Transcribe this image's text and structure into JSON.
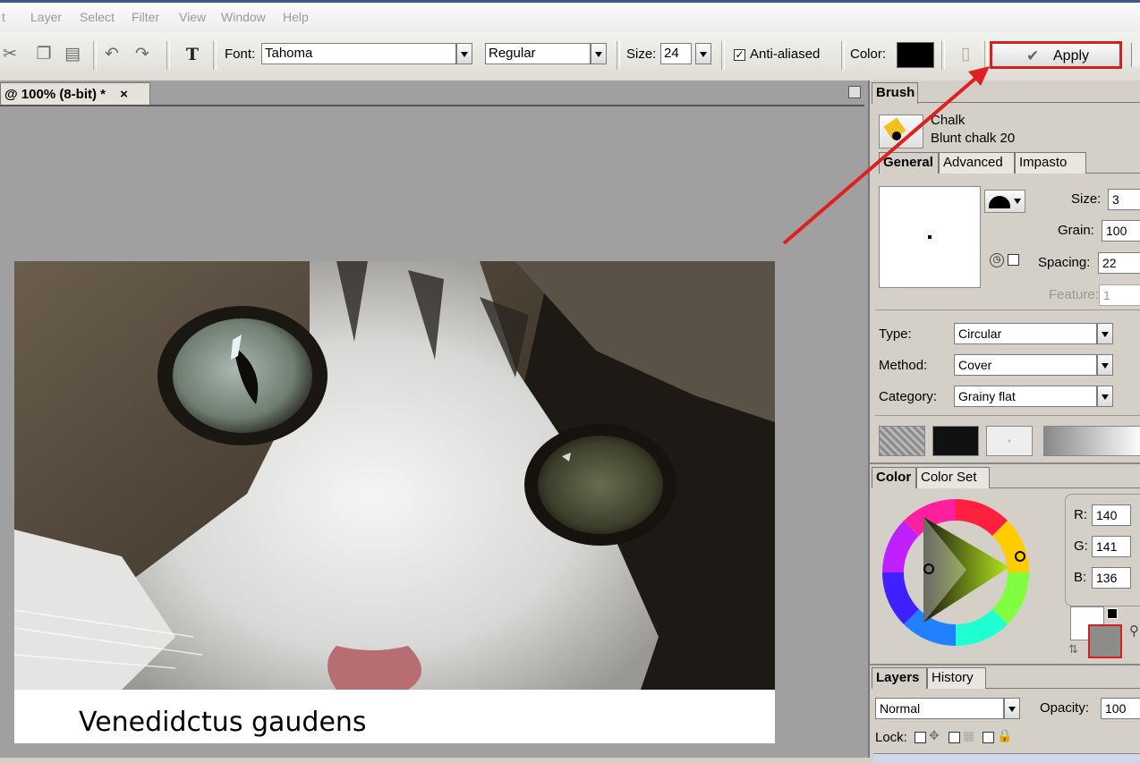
{
  "menu": [
    "t",
    "Layer",
    "Select",
    "Filter",
    "View",
    "Window",
    "Help"
  ],
  "toolbar": {
    "font_label": "Font:",
    "font_value": "Tahoma",
    "style_value": "Regular",
    "size_label": "Size:",
    "size_value": "24",
    "antialias_label": "Anti-aliased",
    "antialias_checked": true,
    "color_label": "Color:",
    "color_value": "#000000",
    "apply_label": "Apply"
  },
  "document": {
    "tab_title": "@ 100% (8-bit) *",
    "close_glyph": "×",
    "caption_text": "Venedidctus gaudens"
  },
  "brush": {
    "panel_tab": "Brush",
    "category_name": "Chalk",
    "variant_name": "Blunt chalk 20",
    "tabs": [
      "General",
      "Advanced",
      "Impasto"
    ],
    "size_label": "Size:",
    "size_value": "3",
    "grain_label": "Grain:",
    "grain_value": "100",
    "spacing_label": "Spacing:",
    "spacing_value": "22",
    "feature_label": "Feature:",
    "feature_value": "1",
    "type_label": "Type:",
    "type_value": "Circular",
    "method_label": "Method:",
    "method_value": "Cover",
    "category_label": "Category:",
    "category_value": "Grainy flat"
  },
  "color": {
    "tabs": [
      "Color",
      "Color Set"
    ],
    "r_label": "R:",
    "r_value": "140",
    "g_label": "G:",
    "g_value": "141",
    "b_label": "B:",
    "b_value": "136",
    "main_color": "#8c8d88",
    "secondary_color": "#ffffff"
  },
  "layers": {
    "tabs": [
      "Layers",
      "History"
    ],
    "blend_mode": "Normal",
    "opacity_label": "Opacity:",
    "opacity_value": "100",
    "lock_label": "Lock:"
  },
  "annotation": {
    "highlight_color": "#e02020"
  }
}
